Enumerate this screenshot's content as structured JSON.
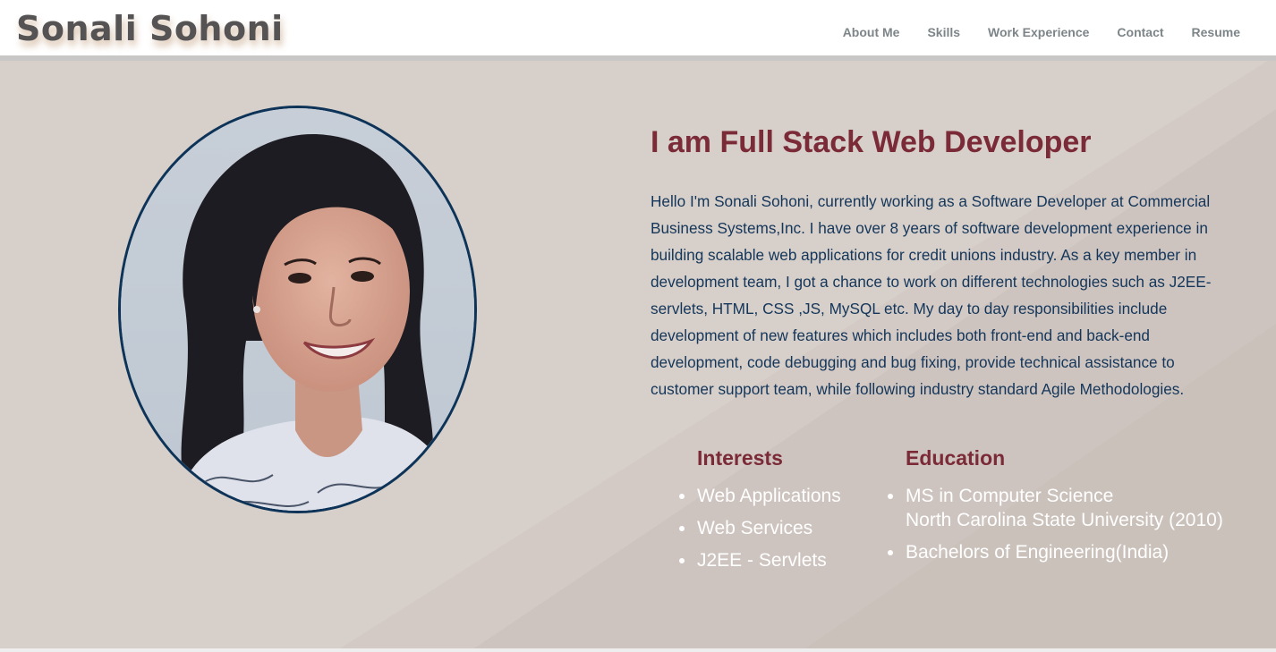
{
  "header": {
    "brand": "Sonali Sohoni",
    "nav": [
      "About Me",
      "Skills",
      "Work Experience",
      "Contact",
      "Resume"
    ]
  },
  "hero": {
    "headline": "I am Full Stack Web Developer",
    "bio": "Hello I'm Sonali Sohoni, currently working as a Software Developer at Commercial Business Systems,Inc. I have over 8 years of software development experience in building scalable web applications for credit unions industry. As a key member in development team, I got a chance to work on different technologies such as J2EE- servlets, HTML, CSS ,JS, MySQL etc. My day to day responsibilities include development of new features which includes both front-end and back-end development, code debugging and bug fixing, provide technical assistance to customer support team, while following industry standard Agile Methodologies.",
    "interests": {
      "title": "Interests",
      "items": [
        "Web Applications",
        "Web Services",
        "J2EE - Servlets"
      ]
    },
    "education": {
      "title": "Education",
      "items": [
        {
          "line1": "MS in Computer Science",
          "line2": "North Carolina State University (2010)"
        },
        {
          "line1": "Bachelors of Engineering(India)",
          "line2": ""
        }
      ]
    }
  },
  "colors": {
    "accent": "#7b2a38",
    "text": "#14365a",
    "nav": "#7d8588",
    "background": "#d7cfc9"
  }
}
